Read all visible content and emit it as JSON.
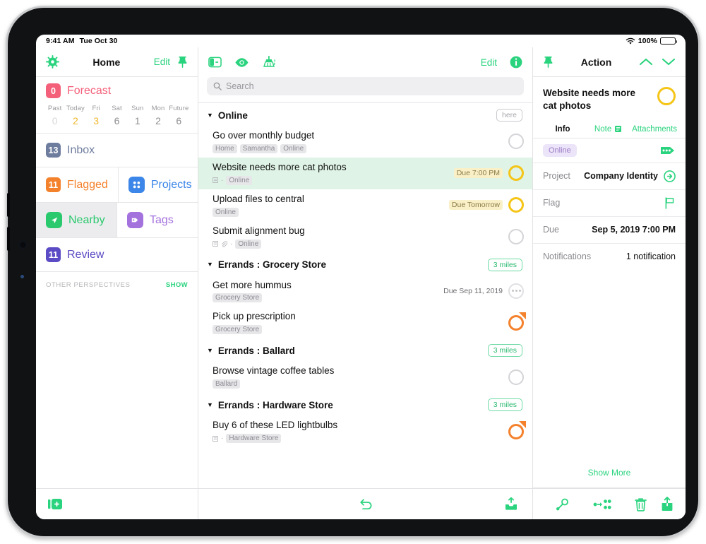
{
  "status_bar": {
    "time": "9:41 AM",
    "date": "Tue Oct 30",
    "battery_percent": "100%",
    "wifi_icon": "wifi-icon",
    "battery_icon": "battery-icon"
  },
  "sidebar": {
    "header": {
      "settings_icon": "gear-icon",
      "title": "Home",
      "edit_label": "Edit",
      "pin_icon": "pin-icon"
    },
    "forecast": {
      "badge": "0",
      "label": "Forecast",
      "badge_color": "#F4607A",
      "days": [
        {
          "name": "Past",
          "count": "0",
          "state": "dim"
        },
        {
          "name": "Today",
          "count": "2",
          "state": "highlight"
        },
        {
          "name": "Fri",
          "count": "3",
          "state": "highlight"
        },
        {
          "name": "Sat",
          "count": "6",
          "state": "normal"
        },
        {
          "name": "Sun",
          "count": "1",
          "state": "normal"
        },
        {
          "name": "Mon",
          "count": "2",
          "state": "normal"
        },
        {
          "name": "Future",
          "count": "6",
          "state": "normal"
        }
      ]
    },
    "items": [
      {
        "badge": "13",
        "label": "Inbox",
        "color": "#6E7C9E",
        "icon": "inbox-icon"
      },
      {
        "badge": "11",
        "label": "Flagged",
        "color": "#F4812B",
        "icon": "flag-icon"
      },
      {
        "badge": "",
        "label": "Projects",
        "color": "#3B86E8",
        "icon": "projects-icon"
      },
      {
        "badge": "",
        "label": "Nearby",
        "color": "#2BC96E",
        "icon": "location-arrow-icon"
      },
      {
        "badge": "",
        "label": "Tags",
        "color": "#A472DD",
        "icon": "tag-icon"
      },
      {
        "badge": "11",
        "label": "Review",
        "color": "#5B4BC4",
        "icon": "review-icon"
      }
    ],
    "other_perspectives": {
      "label": "OTHER PERSPECTIVES",
      "show_label": "SHOW"
    },
    "toolbar": {
      "new_inbox_item_icon": "new-inbox-item-icon"
    }
  },
  "content": {
    "header": {
      "sidebar_toggle_icon": "sidebar-toggle-icon",
      "view_options_icon": "eye-icon",
      "cleanup_icon": "broom-icon",
      "edit_label": "Edit",
      "info_icon": "info-icon"
    },
    "search": {
      "placeholder": "Search",
      "value": "",
      "icon": "search-icon"
    },
    "groups": [
      {
        "title": "Online",
        "pill": "here",
        "pill_style": "gray",
        "tasks": [
          {
            "title": "Go over monthly budget",
            "meta_icons": [],
            "tags": [
              "Home",
              "Samantha",
              "Online"
            ],
            "due": "",
            "due_style": "none",
            "status": "open",
            "selected": false
          },
          {
            "title": "Website needs more cat photos",
            "meta_icons": [
              "note-icon"
            ],
            "tags": [
              "Online"
            ],
            "due": "Due 7:00 PM",
            "due_style": "highlight",
            "status": "due",
            "selected": true
          },
          {
            "title": "Upload files to central",
            "meta_icons": [],
            "tags": [
              "Online"
            ],
            "due": "Due Tomorrow",
            "due_style": "highlight",
            "status": "due",
            "selected": false
          },
          {
            "title": "Submit alignment bug",
            "meta_icons": [
              "note-icon",
              "attachment-icon"
            ],
            "tags": [
              "Online"
            ],
            "due": "",
            "due_style": "none",
            "status": "open",
            "selected": false
          }
        ]
      },
      {
        "title": "Errands : Grocery Store",
        "pill": "3 miles",
        "pill_style": "green",
        "tasks": [
          {
            "title": "Get more hummus",
            "meta_icons": [],
            "tags": [
              "Grocery Store"
            ],
            "due": "Due Sep 11, 2019",
            "due_style": "plain",
            "status": "dots",
            "selected": false
          },
          {
            "title": "Pick up prescription",
            "meta_icons": [],
            "tags": [
              "Grocery Store"
            ],
            "due": "",
            "due_style": "none",
            "status": "flagged",
            "selected": false
          }
        ]
      },
      {
        "title": "Errands : Ballard",
        "pill": "3 miles",
        "pill_style": "green",
        "tasks": [
          {
            "title": "Browse vintage coffee tables",
            "meta_icons": [],
            "tags": [
              "Ballard"
            ],
            "due": "",
            "due_style": "none",
            "status": "open",
            "selected": false
          }
        ]
      },
      {
        "title": "Errands : Hardware Store",
        "pill": "3 miles",
        "pill_style": "green",
        "tasks": [
          {
            "title": "Buy 6 of these LED lightbulbs",
            "meta_icons": [
              "note-icon"
            ],
            "tags": [
              "Hardware Store"
            ],
            "due": "",
            "due_style": "none",
            "status": "flagged",
            "selected": false
          }
        ]
      }
    ],
    "toolbar": {
      "undo_icon": "undo-icon",
      "new_inbox_icon": "inbox-add-icon"
    }
  },
  "inspector": {
    "header": {
      "pin_icon": "pin-icon",
      "title": "Action",
      "up_icon": "chevron-up-icon",
      "down_icon": "chevron-down-icon"
    },
    "task_title": "Website needs more cat photos",
    "task_status": "due",
    "tabs": [
      {
        "label": "Info",
        "active": true,
        "icon": ""
      },
      {
        "label": "Note",
        "active": false,
        "icon": "note-icon"
      },
      {
        "label": "Attachments",
        "active": false,
        "icon": ""
      }
    ],
    "tag": "Online",
    "tag_action_icon": "tag-edit-icon",
    "rows": [
      {
        "key": "Project",
        "value": "Company Identity",
        "icon": "arrow-right-circle-icon"
      },
      {
        "key": "Flag",
        "value": "",
        "icon": "flag-outline-icon"
      },
      {
        "key": "Due",
        "value": "Sep 5, 2019  7:00 PM",
        "icon": ""
      },
      {
        "key": "Notifications",
        "value": "1 notification",
        "icon": ""
      }
    ],
    "show_more_label": "Show More",
    "toolbar": {
      "tag_icon": "tag-assign-icon",
      "project_icon": "project-assign-icon",
      "delete_icon": "trash-icon",
      "share_icon": "share-icon"
    }
  },
  "colors": {
    "accent_green": "#2AD37E",
    "due_amber": "#F5C518",
    "flag_orange": "#F4812B",
    "forecast_pink": "#F4607A",
    "tag_purple": "#A472DD",
    "selection_green": "#DFF3E6"
  }
}
